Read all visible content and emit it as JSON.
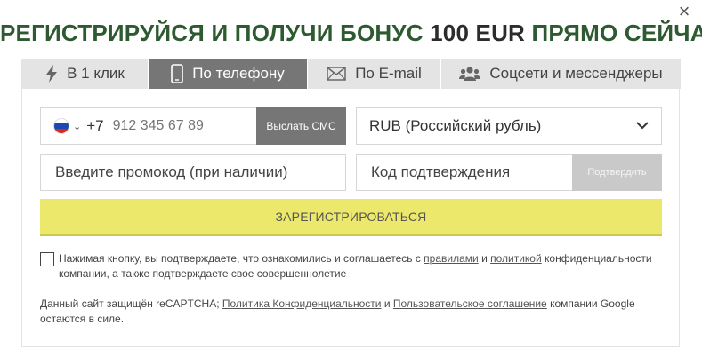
{
  "close_label": "×",
  "title": {
    "part1": "РЕГИСТРИРУЙСЯ И ПОЛУЧИ БОНУС ",
    "amount": "100 EUR",
    "part2": " ПРЯМО СЕЙЧАС!"
  },
  "tabs": [
    {
      "label": "В 1 клик",
      "icon": "lightning-icon",
      "active": false
    },
    {
      "label": "По телефону",
      "icon": "phone-icon",
      "active": true
    },
    {
      "label": "По E-mail",
      "icon": "envelope-icon",
      "active": false
    },
    {
      "label": "Соцсети и мессенджеры",
      "icon": "users-icon",
      "active": false
    }
  ],
  "phone": {
    "country_flag": "russia-flag-icon",
    "prefix": "+7",
    "placeholder": "912 345 67 89",
    "send_sms_label": "Выслать СМС"
  },
  "currency": {
    "selected": "RUB (Российский рубль)"
  },
  "promo": {
    "placeholder": "Введите промокод (при наличии)"
  },
  "confirmation": {
    "placeholder": "Код подтверждения",
    "confirm_label": "Подтвердить"
  },
  "register_label": "ЗАРЕГИСТРИРОВАТЬСЯ",
  "consent": {
    "text1": "Нажимая кнопку, вы подтверждаете, что ознакомились и соглашаетесь с ",
    "link_rules": "правилами",
    "and": " и ",
    "link_policy": "политикой",
    "text2": " конфиденциальности компании, а также подтверждаете свое совершеннолетие"
  },
  "recaptcha": {
    "text1": "Данный сайт защищён reCAPTCHA; ",
    "link_privacy": "Политика Конфиденциальности",
    "and": " и ",
    "link_terms": "Пользовательское соглашение",
    "text2": " компании Google остаются в силе."
  },
  "colors": {
    "title_green": "#2e5a32",
    "active_tab": "#767676",
    "register_yellow": "#ece86b"
  }
}
